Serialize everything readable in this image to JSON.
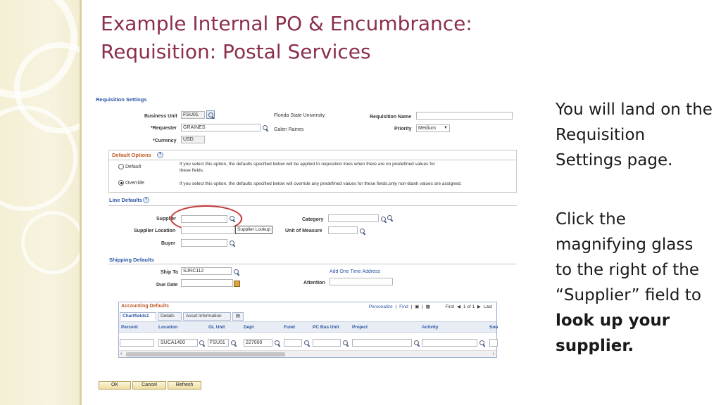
{
  "slide": {
    "title_line1": "Example Internal PO & Encumbrance:",
    "title_line2": "Requisition: Postal Services",
    "note1": "You will land on the Requisition Settings page.",
    "note2_pre": "Click the magnifying glass to the right of the “Supplier” field to ",
    "note2_bold": "look up your supplier."
  },
  "requisition_settings": {
    "heading": "Requisition Settings",
    "business_unit_label": "Business Unit",
    "business_unit_value": "FSU01",
    "business_unit_desc": "Florida State University",
    "requester_label": "*Requester",
    "requester_value": "GRAINES",
    "requester_desc": "Galen Raines",
    "currency_label": "*Currency",
    "currency_value": "USD",
    "requisition_name_label": "Requisition Name",
    "requisition_name_value": "",
    "priority_label": "Priority",
    "priority_value": "Medium"
  },
  "default_options": {
    "heading": "Default Options",
    "default_label": "Default",
    "default_desc_line1": "If you select this option, the defaults specified below will be applied to requisition lines when there are no predefined values for",
    "default_desc_line2": "these fields.",
    "override_label": "Override",
    "override_desc": "If you select this option, the defaults specified below will override any predefined values for these fields,only non-blank values are assigned.",
    "selected": "Override"
  },
  "line_defaults": {
    "heading": "Line Defaults",
    "supplier_label": "Supplier",
    "supplier_value": "",
    "supplier_location_label": "Supplier Location",
    "supplier_location_value": "",
    "buyer_label": "Buyer",
    "buyer_value": "",
    "category_label": "Category",
    "category_value": "",
    "uom_label": "Unit of Measure",
    "uom_value": "",
    "tooltip": "Supplier Lookup"
  },
  "shipping_defaults": {
    "heading": "Shipping Defaults",
    "ship_to_label": "Ship To",
    "ship_to_value": "SJRC112",
    "add_address_link": "Add One Time Address",
    "due_date_label": "Due Date",
    "due_date_value": "",
    "attention_label": "Attention",
    "attention_value": ""
  },
  "accounting_defaults": {
    "heading": "Accounting Defaults",
    "personalize": "Personalize",
    "find": "Find",
    "first": "First",
    "range": "1 of 1",
    "last": "Last",
    "tabs": [
      "Chartfields1",
      "Details",
      "Asset Information"
    ],
    "columns": [
      "Percent",
      "Location",
      "GL Unit",
      "Dept",
      "Fund",
      "PC Bus Unit",
      "Project",
      "Activity",
      "Sou"
    ],
    "row": {
      "percent": "",
      "location": "SUCA1400",
      "gl_unit": "FSU01",
      "dept": "227000",
      "fund": "",
      "pc_bus_unit": "",
      "project": "",
      "activity": "",
      "sou": ""
    }
  },
  "buttons": {
    "ok": "OK",
    "cancel": "Cancel",
    "refresh": "Refresh"
  }
}
